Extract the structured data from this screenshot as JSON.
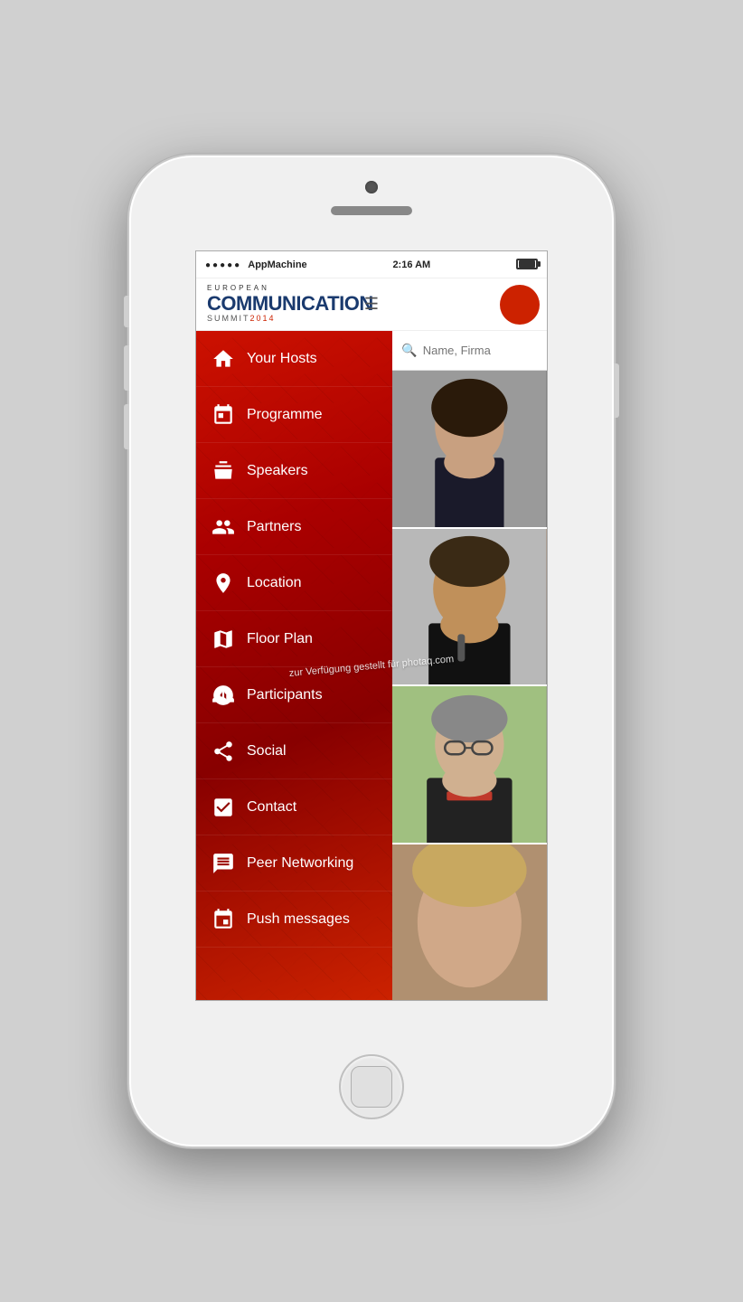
{
  "phone": {
    "status_bar": {
      "carrier": "AppMachine",
      "time": "2:16 AM",
      "dots": "●●●●●"
    },
    "header": {
      "logo_european": "EUROPEAN",
      "logo_communication": "COMMUNICATION",
      "logo_summit": "SUMMIT",
      "logo_year": "2014"
    },
    "menu": {
      "items": [
        {
          "id": "your-hosts",
          "label": "Your Hosts",
          "icon": "house"
        },
        {
          "id": "programme",
          "label": "Programme",
          "icon": "calendar"
        },
        {
          "id": "speakers",
          "label": "Speakers",
          "icon": "podium"
        },
        {
          "id": "partners",
          "label": "Partners",
          "icon": "people"
        },
        {
          "id": "location",
          "label": "Location",
          "icon": "pin"
        },
        {
          "id": "floor-plan",
          "label": "Floor Plan",
          "icon": "map"
        },
        {
          "id": "participants",
          "label": "Participants",
          "icon": "group"
        },
        {
          "id": "social",
          "label": "Social",
          "icon": "social"
        },
        {
          "id": "contact",
          "label": "Contact",
          "icon": "check"
        },
        {
          "id": "peer-networking",
          "label": "Peer Networking",
          "icon": "chat"
        },
        {
          "id": "push-messages",
          "label": "Push messages",
          "icon": "phone-msg"
        }
      ]
    },
    "search": {
      "placeholder": "Name, Firma"
    },
    "watermark": "zur Verfügung gestellt für photaq.com"
  }
}
